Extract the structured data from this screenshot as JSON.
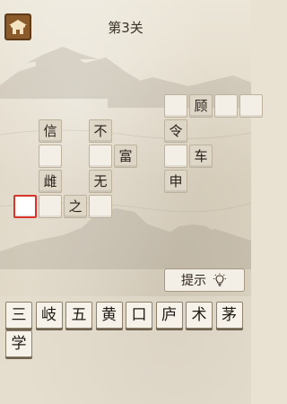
{
  "header": {
    "level": "第3关"
  },
  "grid": {
    "cells": [
      {
        "id": "r0c6",
        "text": "",
        "state": "empty"
      },
      {
        "id": "r0c7",
        "text": "顾",
        "state": "given"
      },
      {
        "id": "r0c8",
        "text": "",
        "state": "empty"
      },
      {
        "id": "r0c9",
        "text": "",
        "state": "empty"
      },
      {
        "id": "r1c1",
        "text": "信",
        "state": "given"
      },
      {
        "id": "r1c3",
        "text": "不",
        "state": "given"
      },
      {
        "id": "r1c6",
        "text": "令",
        "state": "given"
      },
      {
        "id": "r2c1",
        "text": "",
        "state": "empty"
      },
      {
        "id": "r2c3",
        "text": "",
        "state": "empty"
      },
      {
        "id": "r2c4",
        "text": "富",
        "state": "given"
      },
      {
        "id": "r2c6",
        "text": "",
        "state": "empty"
      },
      {
        "id": "r2c7",
        "text": "车",
        "state": "given"
      },
      {
        "id": "r3c1",
        "text": "雌",
        "state": "given"
      },
      {
        "id": "r3c3",
        "text": "无",
        "state": "given"
      },
      {
        "id": "r3c6",
        "text": "申",
        "state": "given"
      },
      {
        "id": "r4c0",
        "text": "",
        "state": "selected"
      },
      {
        "id": "r4c1",
        "text": "",
        "state": "empty"
      },
      {
        "id": "r4c2",
        "text": "之",
        "state": "given"
      },
      {
        "id": "r4c3",
        "text": "",
        "state": "empty"
      }
    ]
  },
  "hint": {
    "label": "提示"
  },
  "candidates": [
    "三",
    "岐",
    "五",
    "黄",
    "口",
    "庐",
    "术",
    "茅",
    "学"
  ]
}
